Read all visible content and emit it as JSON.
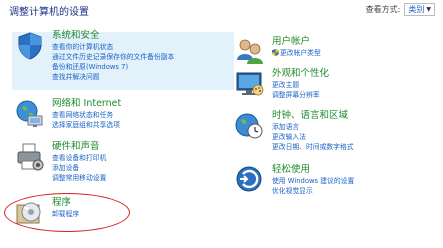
{
  "page": {
    "title": "调整计算机的设置",
    "view_by_label": "查看方式:",
    "view_by_value": "类别"
  },
  "categories": {
    "system": {
      "title": "系统和安全",
      "links": [
        "查看你的计算机状态",
        "通过文件历史记录保存你的文件备份副本",
        "备份和还原(Windows 7)",
        "查找并解决问题"
      ]
    },
    "network": {
      "title": "网络和 Internet",
      "links": [
        "查看网络状态和任务",
        "选择家庭组和共享选项"
      ]
    },
    "hardware": {
      "title": "硬件和声音",
      "links": [
        "查看设备和打印机",
        "添加设备",
        "调整常用移动设置"
      ]
    },
    "programs": {
      "title": "程序",
      "links": [
        "卸载程序"
      ]
    },
    "accounts": {
      "title": "用户帐户",
      "links": [
        "更改帐户类型"
      ]
    },
    "appearance": {
      "title": "外观和个性化",
      "links": [
        "更改主题",
        "调整屏幕分辨率"
      ]
    },
    "clock": {
      "title": "时钟、语言和区域",
      "links": [
        "添加语言",
        "更改输入法",
        "更改日期、时间或数字格式"
      ]
    },
    "ease": {
      "title": "轻松使用",
      "links": [
        "使用 Windows 建议的设置",
        "优化视觉显示"
      ]
    }
  },
  "colors": {
    "heading_green": "#1e8a2e",
    "link_blue": "#1a63c6",
    "highlight_bg": "#e3f1fb",
    "annotation_red": "#d81e1e"
  }
}
